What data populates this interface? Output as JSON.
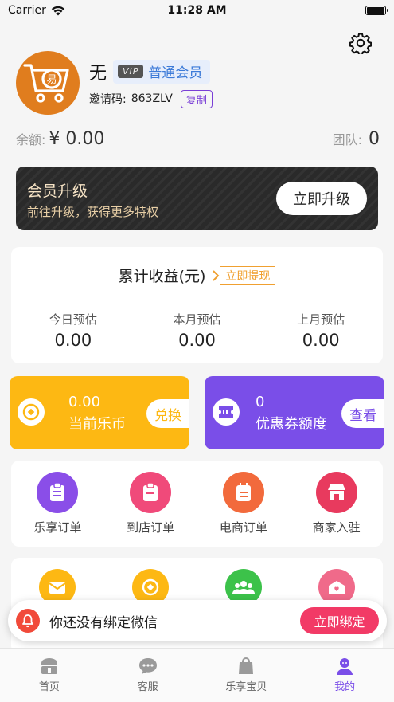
{
  "status_bar": {
    "carrier": "Carrier",
    "time": "11:28 AM"
  },
  "profile": {
    "username": "无",
    "vip_tag": "VIP",
    "vip_level": "普通会员",
    "invite_label": "邀请码:",
    "invite_code": "863ZLV",
    "copy_label": "复制"
  },
  "balance": {
    "balance_label": "余额:",
    "balance_value": "¥ 0.00",
    "team_label": "团队:",
    "team_value": "0"
  },
  "upgrade": {
    "title": "会员升级",
    "subtitle": "前往升级，获得更多特权",
    "button": "立即升级"
  },
  "earnings": {
    "title": "累计收益(元)",
    "withdraw_label": "立即提现",
    "columns": [
      {
        "label": "今日预估",
        "value": "0.00"
      },
      {
        "label": "本月预估",
        "value": "0.00"
      },
      {
        "label": "上月预估",
        "value": "0.00"
      }
    ]
  },
  "coins": {
    "value": "0.00",
    "label": "当前乐币",
    "button": "兑换",
    "color": "#fdb813"
  },
  "coupons": {
    "value": "0",
    "label": "优惠券额度",
    "button": "查看",
    "color": "#7a4ee8"
  },
  "orders": [
    {
      "label": "乐享订单",
      "color": "#8a4ee8",
      "icon": "clipboard-icon"
    },
    {
      "label": "到店订单",
      "color": "#f04a7a",
      "icon": "clipboard-icon"
    },
    {
      "label": "电商订单",
      "color": "#f26a3c",
      "icon": "calendar-icon"
    },
    {
      "label": "商家入驻",
      "color": "#e83a5e",
      "icon": "store-icon"
    }
  ],
  "more_icons": [
    {
      "icon": "mail-icon",
      "color": "#fdb813"
    },
    {
      "icon": "coin-icon",
      "color": "#fdb813"
    },
    {
      "icon": "group-icon",
      "color": "#3cc24a"
    },
    {
      "icon": "heart-box-icon",
      "color": "#f06a8a"
    }
  ],
  "wechat_notice": {
    "text": "你还没有绑定微信",
    "button": "立即绑定"
  },
  "tabs": [
    {
      "label": "首页",
      "active": false
    },
    {
      "label": "客服",
      "active": false
    },
    {
      "label": "乐享宝贝",
      "active": false
    },
    {
      "label": "我的",
      "active": true
    }
  ],
  "colors": {
    "accent": "#7a4ee8",
    "bind": "#f23a66",
    "withdraw": "#f0a030"
  }
}
